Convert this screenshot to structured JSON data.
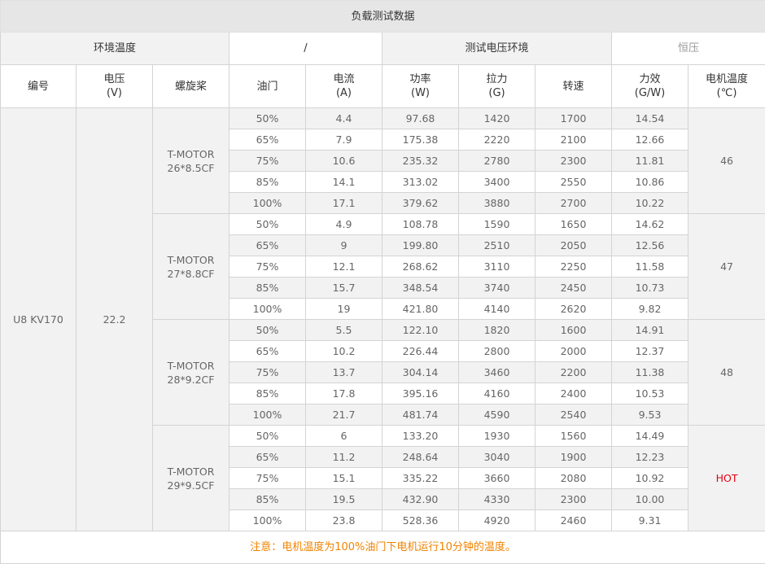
{
  "title": "负载测试数据",
  "env": {
    "ambient_label": "环境温度",
    "ambient_value": "/",
    "voltage_env_label": "测试电压环境",
    "voltage_env_value": "恒压"
  },
  "headers": [
    {
      "line1": "编号",
      "line2": ""
    },
    {
      "line1": "电压",
      "line2": "(V)"
    },
    {
      "line1": "螺旋桨",
      "line2": ""
    },
    {
      "line1": "油门",
      "line2": ""
    },
    {
      "line1": "电流",
      "line2": "(A)"
    },
    {
      "line1": "功率",
      "line2": "(W)"
    },
    {
      "line1": "拉力",
      "line2": "(G)"
    },
    {
      "line1": "转速",
      "line2": ""
    },
    {
      "line1": "力效",
      "line2": "(G/W)"
    },
    {
      "line1": "电机温度",
      "line2": "(℃)"
    }
  ],
  "model": "U8 KV170",
  "voltage": "22.2",
  "groups": [
    {
      "prop_line1": "T-MOTOR",
      "prop_line2": "26*8.5CF",
      "temp": "46",
      "rows": [
        {
          "throttle": "50%",
          "current": "4.4",
          "power": "97.68",
          "thrust": "1420",
          "rpm": "1700",
          "efficiency": "14.54"
        },
        {
          "throttle": "65%",
          "current": "7.9",
          "power": "175.38",
          "thrust": "2220",
          "rpm": "2100",
          "efficiency": "12.66"
        },
        {
          "throttle": "75%",
          "current": "10.6",
          "power": "235.32",
          "thrust": "2780",
          "rpm": "2300",
          "efficiency": "11.81"
        },
        {
          "throttle": "85%",
          "current": "14.1",
          "power": "313.02",
          "thrust": "3400",
          "rpm": "2550",
          "efficiency": "10.86"
        },
        {
          "throttle": "100%",
          "current": "17.1",
          "power": "379.62",
          "thrust": "3880",
          "rpm": "2700",
          "efficiency": "10.22"
        }
      ]
    },
    {
      "prop_line1": "T-MOTOR",
      "prop_line2": "27*8.8CF",
      "temp": "47",
      "rows": [
        {
          "throttle": "50%",
          "current": "4.9",
          "power": "108.78",
          "thrust": "1590",
          "rpm": "1650",
          "efficiency": "14.62"
        },
        {
          "throttle": "65%",
          "current": "9",
          "power": "199.80",
          "thrust": "2510",
          "rpm": "2050",
          "efficiency": "12.56"
        },
        {
          "throttle": "75%",
          "current": "12.1",
          "power": "268.62",
          "thrust": "3110",
          "rpm": "2250",
          "efficiency": "11.58"
        },
        {
          "throttle": "85%",
          "current": "15.7",
          "power": "348.54",
          "thrust": "3740",
          "rpm": "2450",
          "efficiency": "10.73"
        },
        {
          "throttle": "100%",
          "current": "19",
          "power": "421.80",
          "thrust": "4140",
          "rpm": "2620",
          "efficiency": "9.82"
        }
      ]
    },
    {
      "prop_line1": "T-MOTOR",
      "prop_line2": "28*9.2CF",
      "temp": "48",
      "rows": [
        {
          "throttle": "50%",
          "current": "5.5",
          "power": "122.10",
          "thrust": "1820",
          "rpm": "1600",
          "efficiency": "14.91"
        },
        {
          "throttle": "65%",
          "current": "10.2",
          "power": "226.44",
          "thrust": "2800",
          "rpm": "2000",
          "efficiency": "12.37"
        },
        {
          "throttle": "75%",
          "current": "13.7",
          "power": "304.14",
          "thrust": "3460",
          "rpm": "2200",
          "efficiency": "11.38"
        },
        {
          "throttle": "85%",
          "current": "17.8",
          "power": "395.16",
          "thrust": "4160",
          "rpm": "2400",
          "efficiency": "10.53"
        },
        {
          "throttle": "100%",
          "current": "21.7",
          "power": "481.74",
          "thrust": "4590",
          "rpm": "2540",
          "efficiency": "9.53"
        }
      ]
    },
    {
      "prop_line1": "T-MOTOR",
      "prop_line2": "29*9.5CF",
      "temp": "HOT",
      "rows": [
        {
          "throttle": "50%",
          "current": "6",
          "power": "133.20",
          "thrust": "1930",
          "rpm": "1560",
          "efficiency": "14.49"
        },
        {
          "throttle": "65%",
          "current": "11.2",
          "power": "248.64",
          "thrust": "3040",
          "rpm": "1900",
          "efficiency": "12.23"
        },
        {
          "throttle": "75%",
          "current": "15.1",
          "power": "335.22",
          "thrust": "3660",
          "rpm": "2080",
          "efficiency": "10.92"
        },
        {
          "throttle": "85%",
          "current": "19.5",
          "power": "432.90",
          "thrust": "4330",
          "rpm": "2300",
          "efficiency": "10.00"
        },
        {
          "throttle": "100%",
          "current": "23.8",
          "power": "528.36",
          "thrust": "4920",
          "rpm": "2460",
          "efficiency": "9.31"
        }
      ]
    }
  ],
  "colors": {
    "hot": "#e60012",
    "note": "#f08300",
    "shade": "#f2f2f2",
    "title_bg": "#e6e6e6"
  },
  "note": "注意：电机温度为100%油门下电机运行10分钟的温度。"
}
